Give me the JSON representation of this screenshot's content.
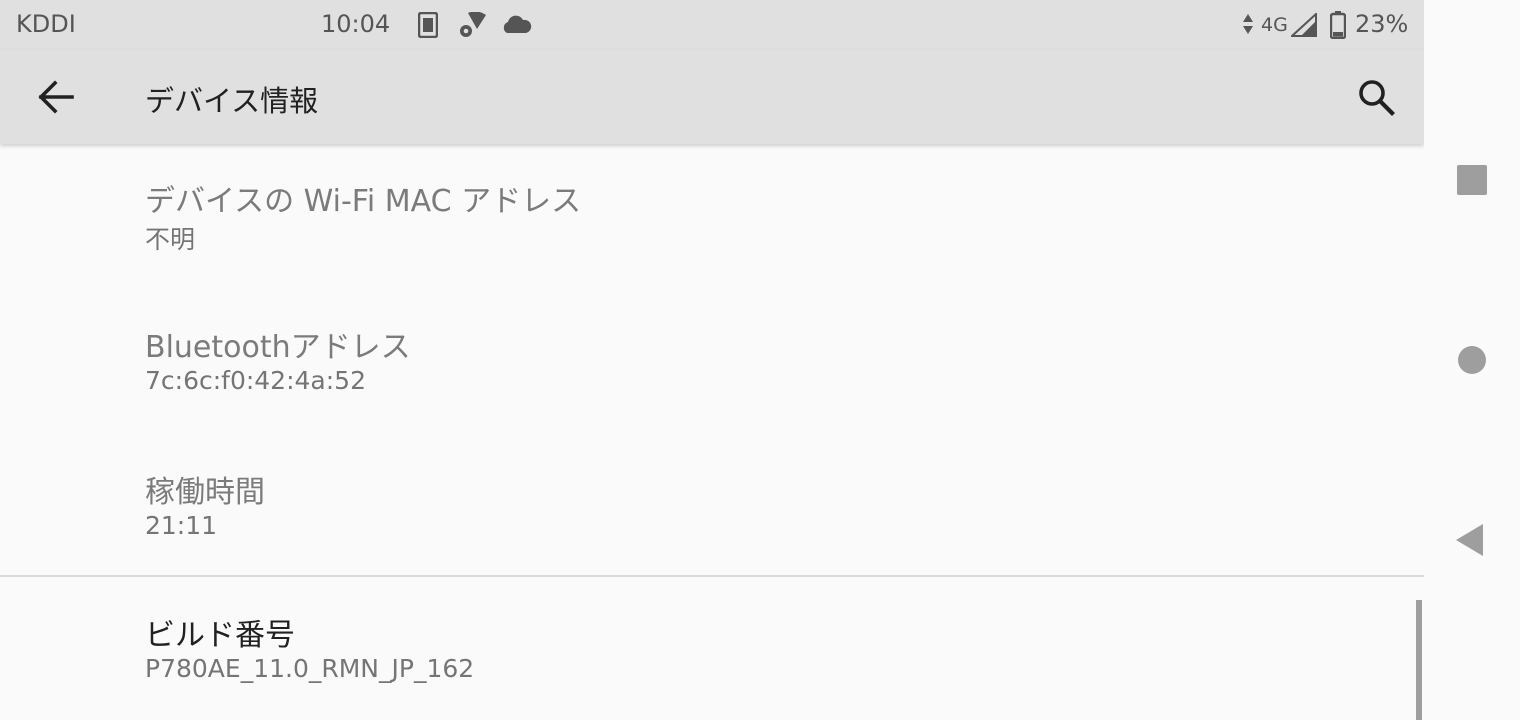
{
  "status_bar": {
    "carrier": "KDDI",
    "time": "10:04",
    "network": "4G",
    "battery": "23%",
    "icons": [
      "sim-card-icon",
      "settings-wifi-icon",
      "cloud-icon",
      "data-arrows-icon",
      "signal-icon",
      "battery-icon"
    ]
  },
  "app_bar": {
    "title": "デバイス情報",
    "back_icon": "arrow-left-icon",
    "search_icon": "search-icon"
  },
  "items": [
    {
      "title": "デバイスの Wi-Fi MAC アドレス",
      "value": "不明"
    },
    {
      "title": "Bluetoothアドレス",
      "value": "7c:6c:f0:42:4a:52"
    },
    {
      "title": "稼働時間",
      "value": "21:11"
    },
    {
      "title": "ビルド番号",
      "value": "P780AE_11.0_RMN_JP_162"
    }
  ],
  "nav_bar": {
    "icons": [
      "recents-square-icon",
      "home-circle-icon",
      "back-triangle-icon"
    ]
  },
  "colors": {
    "bar_background": "#e0e0e0",
    "page_background": "#fafafa",
    "secondary_text": "#757575",
    "primary_text": "#212121"
  }
}
